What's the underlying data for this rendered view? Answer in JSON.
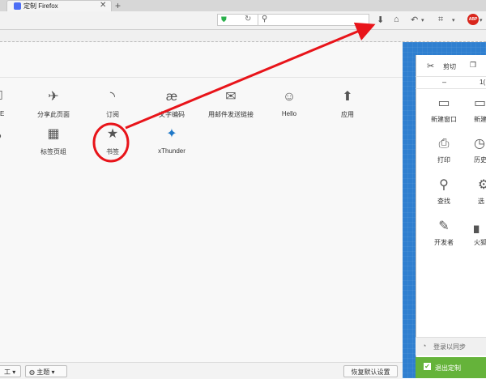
{
  "tab": {
    "title": "定制 Firefox",
    "close": "✕",
    "new_tab": "+"
  },
  "nav": {
    "search_icon": "search-icon",
    "toolbar_icons": [
      "download-icon",
      "home-icon",
      "undo-icon",
      "crop-icon",
      "abp-icon"
    ],
    "abp_text": "ABP"
  },
  "palette": {
    "row1": [
      {
        "label": "分享此页面",
        "icon": "paper-plane-icon",
        "glyph": "✈"
      },
      {
        "label": "订阅",
        "icon": "rss-icon",
        "glyph": "◝"
      },
      {
        "label": "文字编码",
        "icon": "encoding-icon",
        "glyph": "æ"
      },
      {
        "label": "用邮件发送链接",
        "icon": "email-icon",
        "glyph": "✉"
      },
      {
        "label": "Hello",
        "icon": "hello-icon",
        "glyph": "☺"
      },
      {
        "label": "应用",
        "icon": "rocket-icon",
        "glyph": "⬆"
      }
    ],
    "row2": [
      {
        "label": "标签页组",
        "icon": "tab-groups-icon",
        "glyph": "▦"
      },
      {
        "label": "书签",
        "icon": "bookmark-star-icon",
        "glyph": "★"
      },
      {
        "label": "xThunder",
        "icon": "xthunder-icon",
        "glyph": "✦"
      }
    ]
  },
  "menu": {
    "cut": "剪切",
    "zoom_minus": "–",
    "zoom_value": "1(",
    "items": [
      {
        "label": "新建窗口",
        "icon": "new-window-icon",
        "glyph": "▭"
      },
      {
        "label": "打印",
        "icon": "printer-icon",
        "glyph": "⎙"
      },
      {
        "label": "查找",
        "icon": "magnifier-icon",
        "glyph": "⚲"
      },
      {
        "label": "开发者",
        "icon": "wrench-icon",
        "glyph": "✎"
      }
    ],
    "partial_items": [
      {
        "label": "新建隐",
        "icon": "private-window-icon"
      },
      {
        "label": "历史",
        "icon": "history-icon"
      },
      {
        "label": "选",
        "icon": "options-icon"
      },
      {
        "label": "火狐炖",
        "icon": "addons-icon"
      }
    ],
    "sync": "登录以同步",
    "exit": "退出定制"
  },
  "bottom": {
    "toolbars_btn": "工",
    "themes_btn": "主题",
    "restore_btn": "恢复默认设置"
  },
  "colors": {
    "annotation": "#e8141a",
    "panel_blue": "#2f7fd0",
    "exit_green": "#65b33a"
  }
}
